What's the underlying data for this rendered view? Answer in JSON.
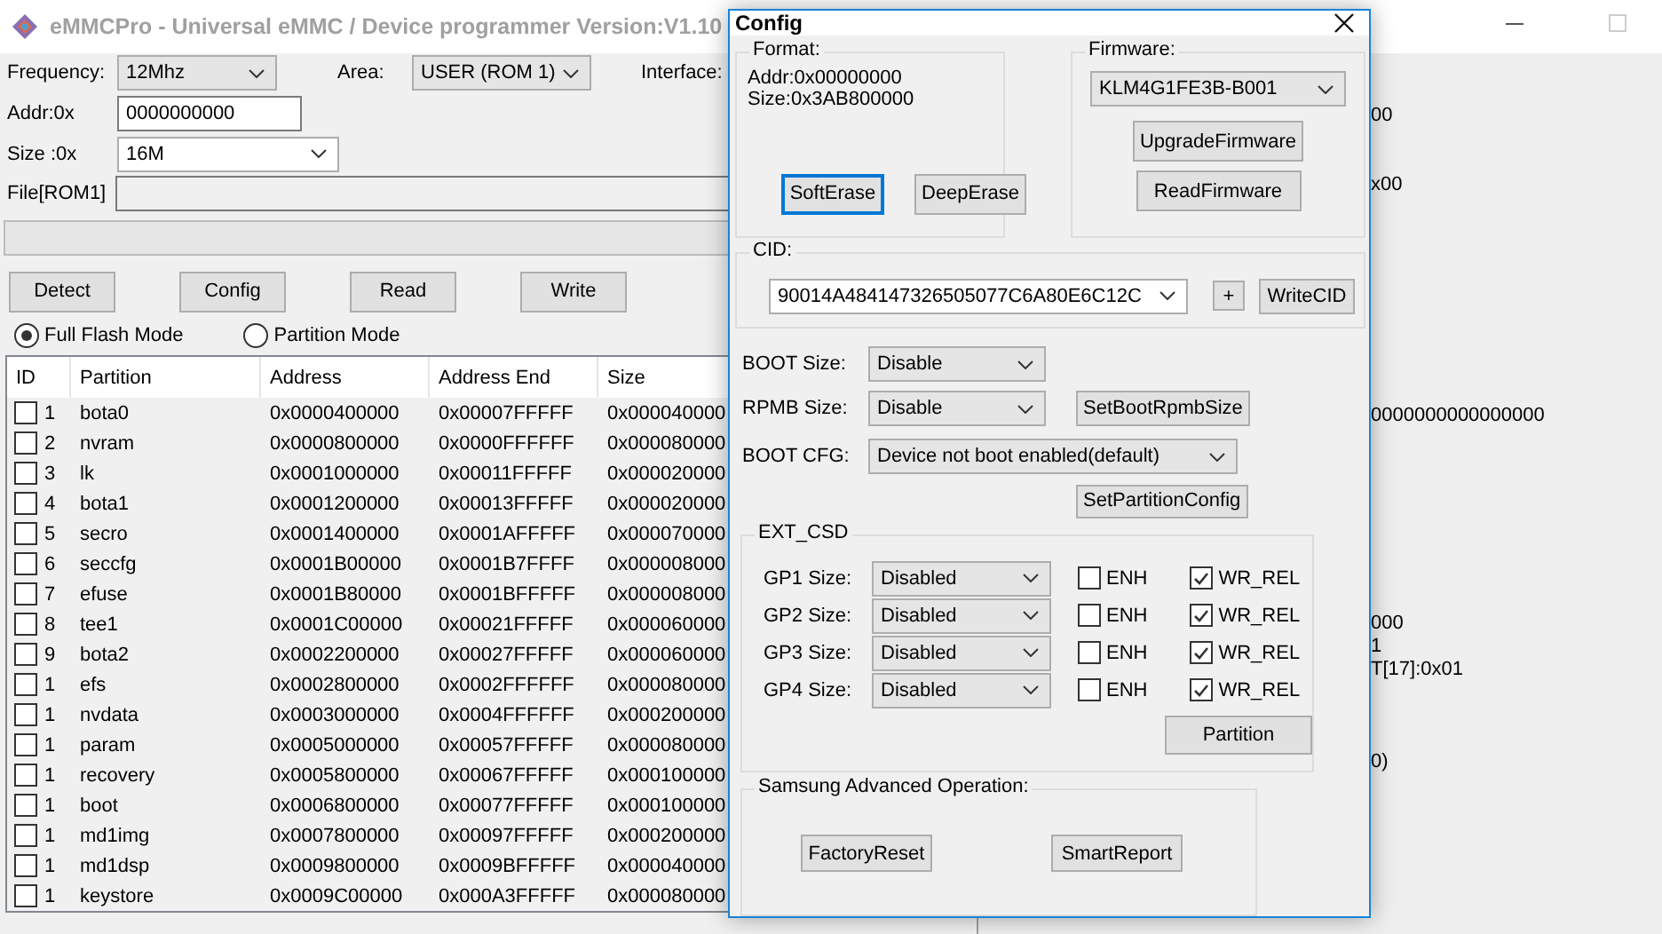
{
  "window": {
    "title": "eMMCPro - Universal eMMC / Device programmer  Version:V1.10"
  },
  "settings": {
    "frequency_label": "Frequency:",
    "frequency": "12Mhz",
    "area_label": "Area:",
    "area": "USER (ROM 1)",
    "interface_label": "Interface:",
    "addr_label": "Addr:0x",
    "addr": "0000000000",
    "size_label": "Size :0x",
    "size": "16M",
    "file_label": "File[ROM1]"
  },
  "progress": {
    "level": 0
  },
  "actions": [
    "Detect",
    "Config",
    "Read",
    "Write"
  ],
  "modes": [
    {
      "label": "Full Flash Mode",
      "selected": true
    },
    {
      "label": "Partition Mode",
      "selected": false
    }
  ],
  "table": {
    "columns": [
      "ID",
      "Partition",
      "Address",
      "Address End",
      "Size"
    ],
    "rows": [
      {
        "checked": false,
        "id": "1",
        "name": "bota0",
        "address": "0x0000400000",
        "end": "0x00007FFFFF",
        "size": "0x000040000"
      },
      {
        "checked": false,
        "id": "2",
        "name": "nvram",
        "address": "0x0000800000",
        "end": "0x0000FFFFFF",
        "size": "0x000080000"
      },
      {
        "checked": false,
        "id": "3",
        "name": "lk",
        "address": "0x0001000000",
        "end": "0x00011FFFFF",
        "size": "0x000020000"
      },
      {
        "checked": false,
        "id": "4",
        "name": "bota1",
        "address": "0x0001200000",
        "end": "0x00013FFFFF",
        "size": "0x000020000"
      },
      {
        "checked": false,
        "id": "5",
        "name": "secro",
        "address": "0x0001400000",
        "end": "0x0001AFFFFF",
        "size": "0x000070000"
      },
      {
        "checked": false,
        "id": "6",
        "name": "seccfg",
        "address": "0x0001B00000",
        "end": "0x0001B7FFFF",
        "size": "0x000008000"
      },
      {
        "checked": false,
        "id": "7",
        "name": "efuse",
        "address": "0x0001B80000",
        "end": "0x0001BFFFFF",
        "size": "0x000008000"
      },
      {
        "checked": false,
        "id": "8",
        "name": "tee1",
        "address": "0x0001C00000",
        "end": "0x00021FFFFF",
        "size": "0x000060000"
      },
      {
        "checked": false,
        "id": "9",
        "name": "bota2",
        "address": "0x0002200000",
        "end": "0x00027FFFFF",
        "size": "0x000060000"
      },
      {
        "checked": false,
        "id": "1",
        "name": "efs",
        "address": "0x0002800000",
        "end": "0x0002FFFFFF",
        "size": "0x000080000"
      },
      {
        "checked": false,
        "id": "1",
        "name": "nvdata",
        "address": "0x0003000000",
        "end": "0x0004FFFFFF",
        "size": "0x000200000"
      },
      {
        "checked": false,
        "id": "1",
        "name": "param",
        "address": "0x0005000000",
        "end": "0x00057FFFFF",
        "size": "0x000080000"
      },
      {
        "checked": false,
        "id": "1",
        "name": "recovery",
        "address": "0x0005800000",
        "end": "0x00067FFFFF",
        "size": "0x000100000"
      },
      {
        "checked": false,
        "id": "1",
        "name": "boot",
        "address": "0x0006800000",
        "end": "0x00077FFFFF",
        "size": "0x000100000"
      },
      {
        "checked": false,
        "id": "1",
        "name": "md1img",
        "address": "0x0007800000",
        "end": "0x00097FFFFF",
        "size": "0x000200000"
      },
      {
        "checked": false,
        "id": "1",
        "name": "md1dsp",
        "address": "0x0009800000",
        "end": "0x0009BFFFFF",
        "size": "0x000040000"
      },
      {
        "checked": false,
        "id": "1",
        "name": "keystore",
        "address": "0x0009C00000",
        "end": "0x000A3FFFFF",
        "size": "0x000080000"
      }
    ]
  },
  "log": [
    "00",
    "x00",
    "0000000000000000",
    "000",
    "1",
    "T[17]:0x01",
    "0)"
  ],
  "config_dialog": {
    "title": "Config",
    "format": {
      "label": "Format:",
      "addr": "Addr:0x00000000",
      "size": "Size:0x3AB800000",
      "buttons": [
        {
          "label": "SoftErase",
          "focused": true
        },
        {
          "label": "DeepErase",
          "focused": false
        }
      ]
    },
    "firmware": {
      "label": "Firmware:",
      "model": "KLM4G1FE3B-B001",
      "buttons": [
        "UpgradeFirmware",
        "ReadFirmware"
      ]
    },
    "cid": {
      "label": "CID:",
      "value": "90014A484147326505077C6A80E6C12C",
      "add": "+",
      "write": "WriteCID"
    },
    "boot_size": {
      "label": "BOOT Size:",
      "value": "Disable"
    },
    "rpmb_size": {
      "label": "RPMB Size:",
      "value": "Disable",
      "button": "SetBootRpmbSize"
    },
    "boot_cfg": {
      "label": "BOOT CFG:",
      "value": "Device not boot enabled(default)",
      "button": "SetPartitionConfig"
    },
    "ext_csd": {
      "label": "EXT_CSD",
      "rows": [
        {
          "label": "GP1 Size:",
          "value": "Disabled",
          "options": [
            {
              "label": "ENH",
              "checked": false
            },
            {
              "label": "WR_REL",
              "checked": true
            }
          ]
        },
        {
          "label": "GP2 Size:",
          "value": "Disabled",
          "options": [
            {
              "label": "ENH",
              "checked": false
            },
            {
              "label": "WR_REL",
              "checked": true
            }
          ]
        },
        {
          "label": "GP3 Size:",
          "value": "Disabled",
          "options": [
            {
              "label": "ENH",
              "checked": false
            },
            {
              "label": "WR_REL",
              "checked": true
            }
          ]
        },
        {
          "label": "GP4 Size:",
          "value": "Disabled",
          "options": [
            {
              "label": "ENH",
              "checked": false
            },
            {
              "label": "WR_REL",
              "checked": true
            }
          ]
        }
      ],
      "button": "Partition"
    },
    "samsung": {
      "label": "Samsung Advanced Operation:",
      "buttons": [
        "FactoryReset",
        "SmartReport"
      ]
    }
  }
}
